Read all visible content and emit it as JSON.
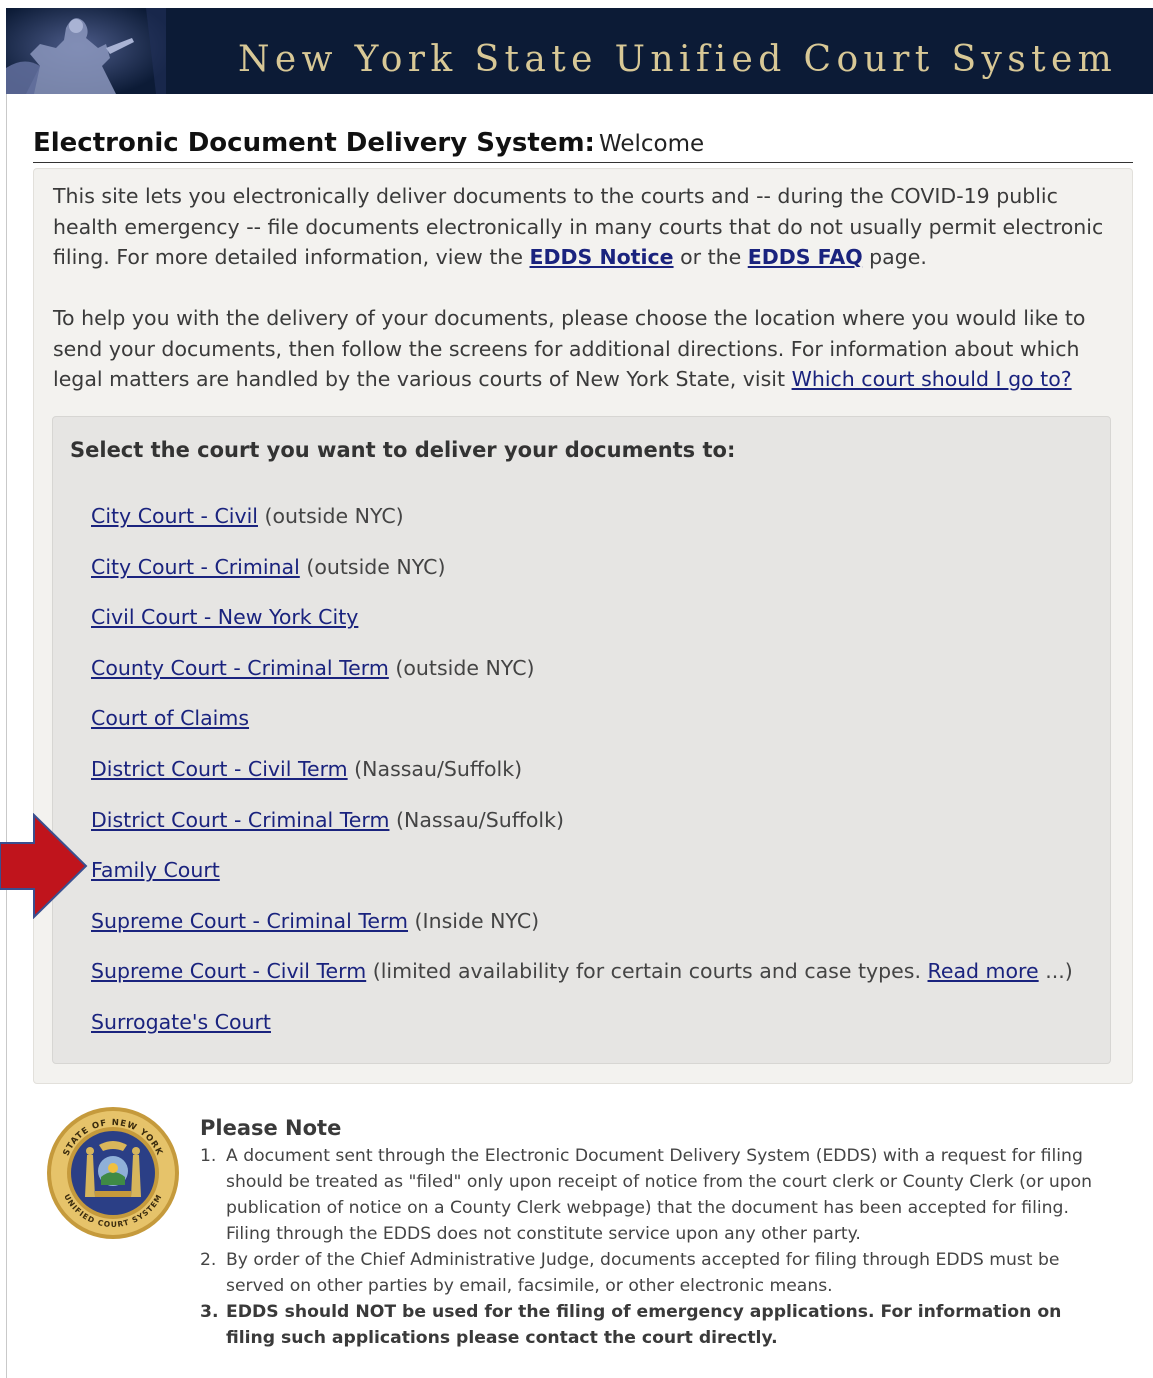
{
  "header": {
    "title": "New York State Unified Court System",
    "background": "#0c1b36",
    "title_color": "#d8c896"
  },
  "page": {
    "heading_strong": "Electronic Document Delivery System:",
    "heading_sub": "Welcome"
  },
  "intro": {
    "p1_text_1": "This site lets you electronically deliver documents to the courts and -- during the COVID-19 public health emergency -- file documents electronically in many courts that do not usually permit electronic filing. For more detailed information, view the ",
    "p1_link_notice": "EDDS Notice",
    "p1_text_2": " or the ",
    "p1_link_faq": "EDDS FAQ",
    "p1_text_3": " page.",
    "p2_text_1": "To help you with the delivery of your documents, please choose the location where you would like to send your documents, then follow the screens for additional directions. For information about which legal matters are handled by the various courts of New York State, visit ",
    "p2_link": "Which court should I go to?"
  },
  "select": {
    "heading": "Select the court you want to deliver your documents to:",
    "courts": [
      {
        "label": "City Court - Civil",
        "note": "(outside NYC)"
      },
      {
        "label": "City Court - Criminal",
        "note": "(outside NYC)"
      },
      {
        "label": "Civil Court - New York City",
        "note": ""
      },
      {
        "label": "County Court - Criminal Term",
        "note": "(outside NYC)"
      },
      {
        "label": "Court of Claims",
        "note": ""
      },
      {
        "label": "District Court - Civil Term",
        "note": "(Nassau/Suffolk)"
      },
      {
        "label": "District Court - Criminal Term",
        "note": "(Nassau/Suffolk)"
      },
      {
        "label": "Family Court",
        "note": ""
      },
      {
        "label": "Supreme Court - Criminal Term",
        "note": "(Inside NYC)"
      },
      {
        "label": "Supreme Court - Civil Term",
        "note": "(limited availability for certain courts and case types.",
        "extra_link": "Read more",
        "note_end": "...)"
      },
      {
        "label": "Surrogate's Court",
        "note": ""
      }
    ]
  },
  "annotation": {
    "arrow_color": "#c0141c",
    "arrow_border": "#3b4f8f"
  },
  "seal": {
    "top_text": "STATE OF NEW YORK",
    "bottom_text": "UNIFIED COURT SYSTEM"
  },
  "note": {
    "title": "Please Note",
    "items": [
      {
        "num": "1.",
        "text": "A document sent through the Electronic Document Delivery System (EDDS) with a request for filing should be treated as \"filed\" only upon receipt of notice from the court clerk or County Clerk (or upon publication of notice on a County Clerk webpage) that the document has been accepted for filing. Filing through the EDDS does not constitute service upon any other party."
      },
      {
        "num": "2.",
        "text": "By order of the Chief Administrative Judge, documents accepted for filing through EDDS must be served on other parties by email, facsimile, or other electronic means."
      },
      {
        "num": "3.",
        "text": "EDDS should NOT be used for the filing of emergency applications. For information on filing such applications please contact the court directly."
      }
    ]
  }
}
